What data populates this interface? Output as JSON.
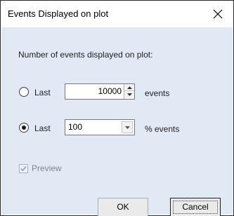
{
  "dialog": {
    "title": "Events Displayed on plot",
    "close_icon": "close-x-icon"
  },
  "content": {
    "heading": "Number of events displayed on plot:",
    "option_last_events": {
      "selected": false,
      "label": "Last",
      "value": "10000",
      "unit": "events",
      "spin_icons": [
        "spin-up-icon",
        "spin-down-icon"
      ]
    },
    "option_last_percent": {
      "selected": true,
      "label": "Last",
      "value": "100",
      "unit": "% events",
      "dropdown_icon": "chevron-down-icon"
    },
    "preview": {
      "checked": true,
      "enabled": false,
      "label": "Preview"
    }
  },
  "buttons": {
    "ok": "OK",
    "cancel": "Cancel"
  }
}
